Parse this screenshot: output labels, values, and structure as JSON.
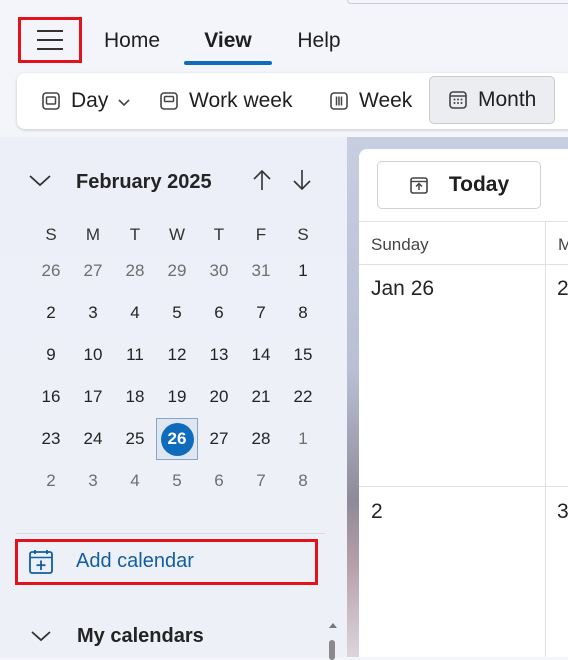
{
  "tabs": [
    {
      "label": "Home",
      "active": false
    },
    {
      "label": "View",
      "active": true
    },
    {
      "label": "Help",
      "active": false
    }
  ],
  "ribbon": {
    "day": "Day",
    "work_week": "Work week",
    "week": "Week",
    "month": "Month"
  },
  "mini_calendar": {
    "title": "February 2025",
    "weekdays": [
      "S",
      "M",
      "T",
      "W",
      "T",
      "F",
      "S"
    ],
    "weeks": [
      [
        "26",
        "27",
        "28",
        "29",
        "30",
        "31",
        "1"
      ],
      [
        "2",
        "3",
        "4",
        "5",
        "6",
        "7",
        "8"
      ],
      [
        "9",
        "10",
        "11",
        "12",
        "13",
        "14",
        "15"
      ],
      [
        "16",
        "17",
        "18",
        "19",
        "20",
        "21",
        "22"
      ],
      [
        "23",
        "24",
        "25",
        "26",
        "27",
        "28",
        "1"
      ],
      [
        "2",
        "3",
        "4",
        "5",
        "6",
        "7",
        "8"
      ]
    ],
    "selected_date": "26"
  },
  "sidebar": {
    "add_calendar": "Add calendar",
    "my_calendars": "My calendars"
  },
  "main": {
    "today_button": "Today",
    "column_headers": [
      "Sunday",
      "M"
    ],
    "row1": [
      "Jan 26",
      "2"
    ],
    "row2": [
      "2",
      "3"
    ]
  },
  "colors": {
    "accent": "#0f6cbd",
    "highlight_border": "#e3121c",
    "link": "#115ea3"
  }
}
